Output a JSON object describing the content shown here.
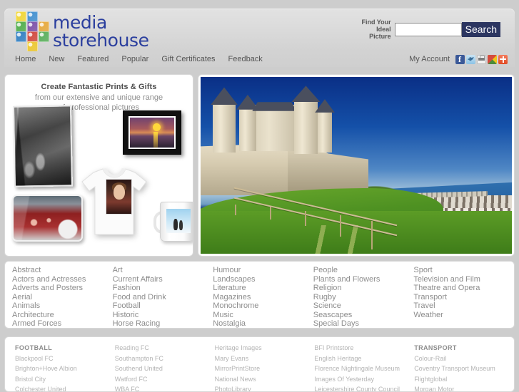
{
  "site": {
    "logo_line1": "media",
    "logo_line2": "storehouse",
    "logo_alt": "media storehouse logo"
  },
  "search": {
    "label_line1": "Find Your",
    "label_line2": "Ideal",
    "label_line3": "Picture",
    "value": "",
    "placeholder": "",
    "button": "Search",
    "button_color": "#2b3560"
  },
  "nav": {
    "items": [
      {
        "label": "Home"
      },
      {
        "label": "New"
      },
      {
        "label": "Featured"
      },
      {
        "label": "Popular"
      },
      {
        "label": "Gift Certificates"
      },
      {
        "label": "Feedback"
      }
    ],
    "account": "My Account",
    "social": [
      {
        "name": "facebook-icon"
      },
      {
        "name": "twitter-icon"
      },
      {
        "name": "print-icon"
      },
      {
        "name": "google-share-icon"
      },
      {
        "name": "add-this-icon"
      }
    ]
  },
  "promo": {
    "title": "Create Fantastic Prints & Gifts",
    "sub_line1": "from our extensive and unique range",
    "sub_line2": "of professional pictures",
    "products": [
      {
        "name": "canvas-print-black-and-white"
      },
      {
        "name": "framed-print-sunset"
      },
      {
        "name": "mousemat-football-celebration"
      },
      {
        "name": "tshirt-portrait-print"
      },
      {
        "name": "mug-penguins"
      }
    ]
  },
  "hero": {
    "name": "hero-photo-chateau-de-saumur",
    "description": "Castle on a hill above a green field, fence line, river with bridge and riverside town"
  },
  "categories": {
    "columns": [
      [
        "Abstract",
        "Actors and Actresses",
        "Adverts and Posters",
        "Aerial",
        "Animals",
        "Architecture",
        "Armed Forces"
      ],
      [
        "Art",
        "Current Affairs",
        "Fashion",
        "Food and Drink",
        "Football",
        "Historic",
        "Horse Racing"
      ],
      [
        "Humour",
        "Landscapes",
        "Literature",
        "Magazines",
        "Monochrome",
        "Music",
        "Nostalgia"
      ],
      [
        "People",
        "Plants and Flowers",
        "Religion",
        "Rugby",
        "Science",
        "Seascapes",
        "Special Days"
      ],
      [
        "Sport",
        "Television and Film",
        "Theatre and Opera",
        "Transport",
        "Travel",
        "Weather"
      ]
    ]
  },
  "partners": {
    "columns": [
      {
        "heading": "FOOTBALL",
        "items": [
          "Blackpool FC",
          "Brighton+Hove Albion",
          "Bristol City",
          "Colchester United"
        ]
      },
      {
        "heading": "",
        "items": [
          "Reading FC",
          "Southampton FC",
          "Southend United",
          "Watford FC",
          "WBA FC"
        ]
      },
      {
        "heading": "",
        "items": [
          "Heritage Images",
          "Mary Evans",
          "MirrorPrintStore",
          "National News",
          "PhotoLibrary"
        ]
      },
      {
        "heading": "",
        "items": [
          "BFI Printstore",
          "English Heritage",
          "Florence Nightingale Museum",
          "Images Of Yesterday",
          "Leicestershire County Council"
        ]
      },
      {
        "heading": "TRANSPORT",
        "items": [
          "Colour-Rail",
          "Coventry Transport Museum",
          "Flightglobal",
          "Morgan Motor"
        ]
      }
    ]
  },
  "theme": {
    "page_bg": "#cdcdcd",
    "header_bg": "#dcdcdc",
    "logo_blue": "#2b3f9e",
    "text_gray": "#8d8d8d"
  }
}
